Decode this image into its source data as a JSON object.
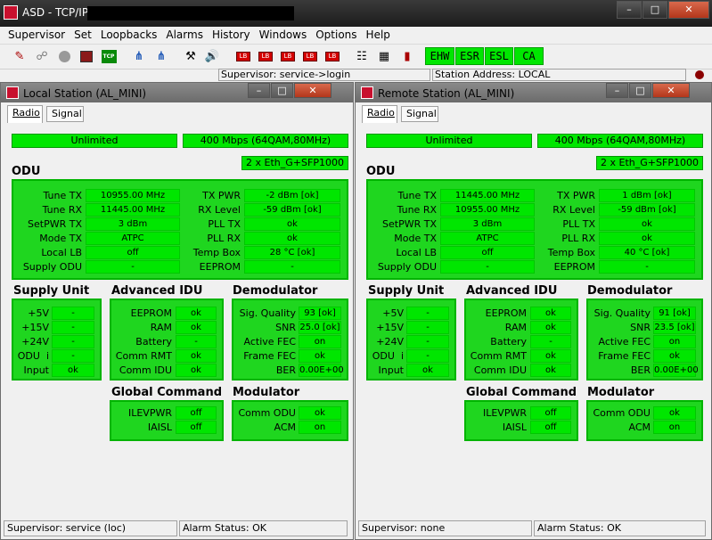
{
  "app": {
    "title": "ASD - TCP/IP"
  },
  "menu": [
    "Supervisor",
    "Set",
    "Loopbacks",
    "Alarms",
    "History",
    "Windows",
    "Options",
    "Help"
  ],
  "alarms": [
    "EHW",
    "ESR",
    "ESL",
    "CA"
  ],
  "status": {
    "supervisor": "Supervisor: service->login",
    "station_address": "Station Address: LOCAL"
  },
  "local": {
    "title": "Local Station (AL_MINI)",
    "tabs": [
      "Radio",
      "Signal"
    ],
    "capacity": "Unlimited",
    "rate": "400 Mbps (64QAM,80MHz)",
    "interface": "2 x Eth_G+SFP1000",
    "odu_title": "ODU",
    "odu_left": [
      [
        "Tune TX",
        "10955.00 MHz"
      ],
      [
        "Tune RX",
        "11445.00 MHz"
      ],
      [
        "SetPWR TX",
        "3 dBm"
      ],
      [
        "Mode TX",
        "ATPC"
      ],
      [
        "Local LB",
        "off"
      ],
      [
        "Supply ODU",
        "-"
      ]
    ],
    "odu_right": [
      [
        "TX PWR",
        "-2 dBm [ok]"
      ],
      [
        "RX Level",
        "-59 dBm [ok]"
      ],
      [
        "PLL TX",
        "ok"
      ],
      [
        "PLL RX",
        "ok"
      ],
      [
        "Temp Box",
        "28 °C [ok]"
      ],
      [
        "EEPROM",
        "-"
      ]
    ],
    "supply_title": "Supply Unit",
    "supply": [
      [
        "+5V",
        "-"
      ],
      [
        "+15V",
        "-"
      ],
      [
        "+24V",
        "-"
      ],
      [
        "ODU  i",
        "-"
      ],
      [
        "Input",
        "ok"
      ]
    ],
    "idu_title": "Advanced IDU",
    "idu": [
      [
        "EEPROM",
        "ok"
      ],
      [
        "RAM",
        "ok"
      ],
      [
        "Battery",
        "-"
      ],
      [
        "Comm RMT",
        "ok"
      ],
      [
        "Comm IDU",
        "ok"
      ]
    ],
    "demod_title": "Demodulator",
    "demod": [
      [
        "Sig. Quality",
        "93 [ok]"
      ],
      [
        "SNR",
        "25.0 [ok]"
      ],
      [
        "Active FEC",
        "on"
      ],
      [
        "Frame FEC",
        "ok"
      ],
      [
        "BER",
        "0.00E+00"
      ]
    ],
    "global_title": "Global Command",
    "global": [
      [
        "ILEVPWR",
        "off"
      ],
      [
        "IAISL",
        "off"
      ]
    ],
    "mod_title": "Modulator",
    "mod": [
      [
        "Comm ODU",
        "ok"
      ],
      [
        "ACM",
        "on"
      ]
    ],
    "status_sup": "Supervisor: service (loc)",
    "status_alarm": "Alarm Status: OK"
  },
  "remote": {
    "title": "Remote Station (AL_MINI)",
    "tabs": [
      "Radio",
      "Signal"
    ],
    "capacity": "Unlimited",
    "rate": "400 Mbps (64QAM,80MHz)",
    "interface": "2 x Eth_G+SFP1000",
    "odu_title": "ODU",
    "odu_left": [
      [
        "Tune TX",
        "11445.00 MHz"
      ],
      [
        "Tune RX",
        "10955.00 MHz"
      ],
      [
        "SetPWR TX",
        "3 dBm"
      ],
      [
        "Mode TX",
        "ATPC"
      ],
      [
        "Local LB",
        "off"
      ],
      [
        "Supply ODU",
        "-"
      ]
    ],
    "odu_right": [
      [
        "TX PWR",
        "1 dBm [ok]"
      ],
      [
        "RX Level",
        "-59 dBm [ok]"
      ],
      [
        "PLL TX",
        "ok"
      ],
      [
        "PLL RX",
        "ok"
      ],
      [
        "Temp Box",
        "40 °C [ok]"
      ],
      [
        "EEPROM",
        "-"
      ]
    ],
    "supply_title": "Supply Unit",
    "supply": [
      [
        "+5V",
        "-"
      ],
      [
        "+15V",
        "-"
      ],
      [
        "+24V",
        "-"
      ],
      [
        "ODU  i",
        "-"
      ],
      [
        "Input",
        "ok"
      ]
    ],
    "idu_title": "Advanced IDU",
    "idu": [
      [
        "EEPROM",
        "ok"
      ],
      [
        "RAM",
        "ok"
      ],
      [
        "Battery",
        "-"
      ],
      [
        "Comm RMT",
        "ok"
      ],
      [
        "Comm IDU",
        "ok"
      ]
    ],
    "demod_title": "Demodulator",
    "demod": [
      [
        "Sig. Quality",
        "91 [ok]"
      ],
      [
        "SNR",
        "23.5 [ok]"
      ],
      [
        "Active FEC",
        "on"
      ],
      [
        "Frame FEC",
        "ok"
      ],
      [
        "BER",
        "0.00E+00"
      ]
    ],
    "global_title": "Global Command",
    "global": [
      [
        "ILEVPWR",
        "off"
      ],
      [
        "IAISL",
        "off"
      ]
    ],
    "mod_title": "Modulator",
    "mod": [
      [
        "Comm ODU",
        "ok"
      ],
      [
        "ACM",
        "on"
      ]
    ],
    "status_sup": "Supervisor: none",
    "status_alarm": "Alarm Status: OK"
  }
}
